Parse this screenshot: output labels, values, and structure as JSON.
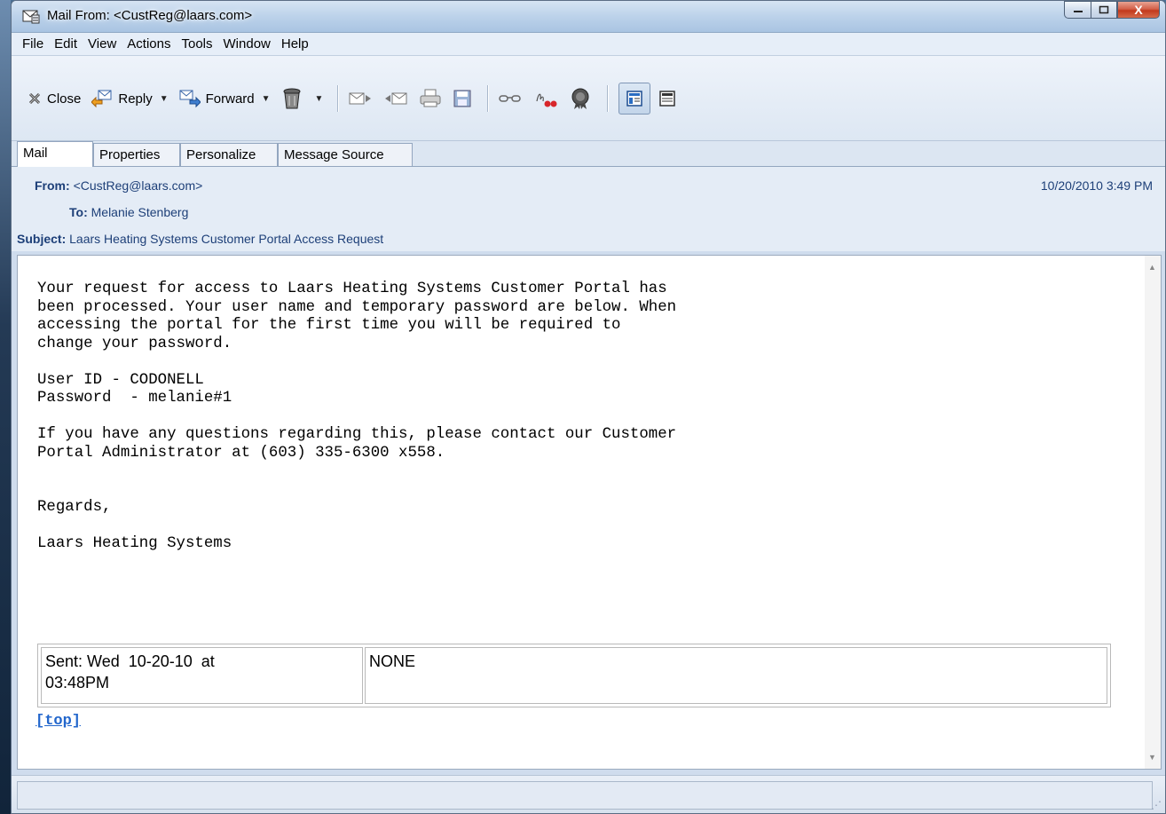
{
  "window": {
    "title": "Mail From: <CustReg@laars.com>",
    "minimize_label": "–",
    "maximize_label": "□",
    "close_label": "X"
  },
  "menu": {
    "items": [
      "File",
      "Edit",
      "View",
      "Actions",
      "Tools",
      "Window",
      "Help"
    ]
  },
  "toolbar": {
    "close_label": "Close",
    "reply_label": "Reply",
    "forward_label": "Forward",
    "dropdown_glyph": "▼"
  },
  "tabs": [
    "Mail",
    "Properties",
    "Personalize",
    "Message Source"
  ],
  "header": {
    "from_label": "From:",
    "from_value": "<CustReg@laars.com>",
    "to_label": "To:",
    "to_value": "Melanie Stenberg",
    "subject_label": "Subject:",
    "subject_value": "Laars Heating Systems Customer Portal Access Request",
    "date": "10/20/2010 3:49 PM"
  },
  "message": {
    "body": "Your request for access to Laars Heating Systems Customer Portal has\nbeen processed. Your user name and temporary password are below. When\naccessing the portal for the first time you will be required to\nchange your password.\n\nUser ID - CODONELL\nPassword  - melanie#1\n\nIf you have any questions regarding this, please contact our Customer\nPortal Administrator at (603) 335-6300 x558.\n\n\nRegards,\n\nLaars Heating Systems",
    "sent_cell": "Sent: Wed  10-20-10  at\n03:48PM",
    "priority_cell": "NONE",
    "top_link": "[top]"
  },
  "colors": {
    "header_text": "#1d3f78",
    "link": "#2266cc",
    "window_frame": "#cfdced"
  }
}
